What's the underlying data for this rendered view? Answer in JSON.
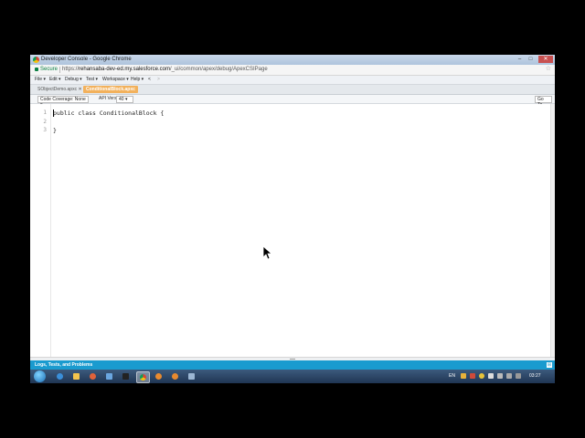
{
  "window": {
    "title": "Developer Console - Google Chrome"
  },
  "window_controls": {
    "minimize": "–",
    "maximize": "□",
    "close": "✕"
  },
  "address_bar": {
    "secure_label": "Secure",
    "url_scheme": "https://",
    "url_host": "rehansaba-dev-ed.my.salesforce.com",
    "url_path": "/_ui/common/apex/debug/ApexCSIPage"
  },
  "menu": [
    {
      "label": "File ▾"
    },
    {
      "label": "Edit ▾"
    },
    {
      "label": "Debug ▾"
    },
    {
      "label": "Test ▾"
    },
    {
      "label": "Workspace ▾"
    },
    {
      "label": "Help ▾"
    },
    {
      "label": "<"
    },
    {
      "label": ">"
    }
  ],
  "file_tabs": [
    {
      "label": "SObjectDemo.apxc ✕",
      "active": false
    },
    {
      "label": "ConditionalBlock.apxc",
      "active": true
    }
  ],
  "toolbar": {
    "code_coverage": "Code Coverage: None ▾",
    "api_version_label": "API Version",
    "api_version_value": "40 ▾",
    "goto": "Go To"
  },
  "editor": {
    "lines": [
      {
        "number": "1",
        "code": "public class ConditionalBlock {"
      },
      {
        "number": "2",
        "code": ""
      },
      {
        "number": "3",
        "code": "}"
      }
    ]
  },
  "bottom_panel": {
    "label": "Logs, Tests, and Problems",
    "expand_icon": "⊞"
  },
  "taskbar": {
    "language": "EN",
    "clock": "03:27",
    "colors": {
      "chrome": "#e8b13a",
      "explorer": "#f3c44d",
      "media": "#e0623a"
    }
  }
}
